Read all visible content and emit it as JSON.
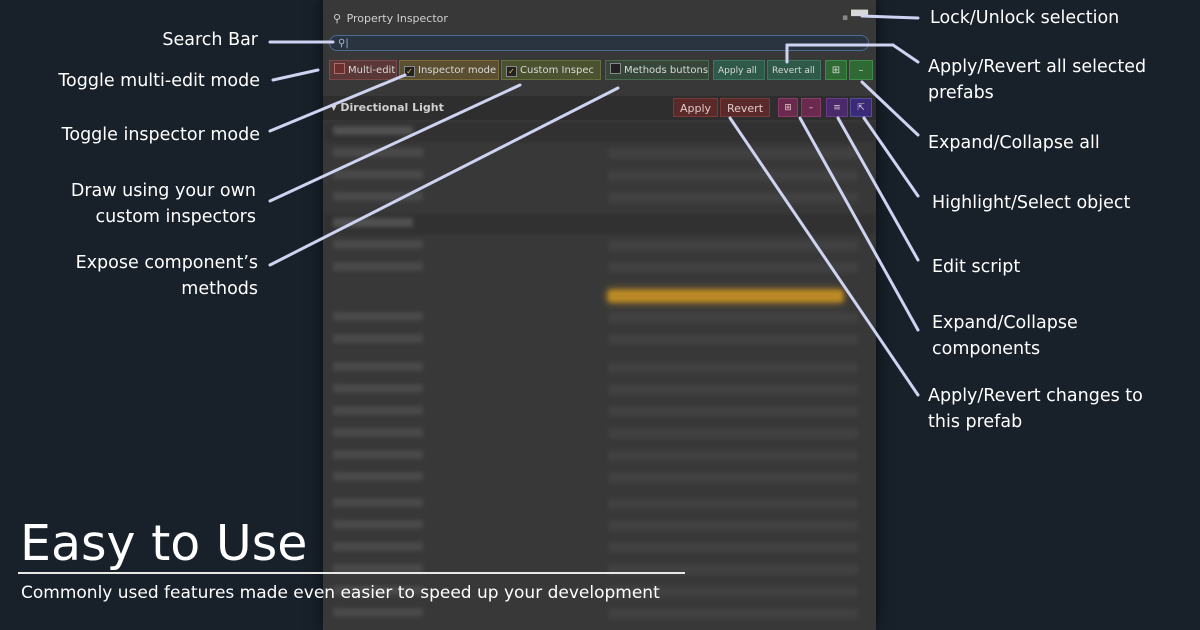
{
  "panel": {
    "title": "Property Inspector",
    "search_placeholder": "",
    "toolbar": {
      "multi_edit": "Multi-edit",
      "inspector_mode": "Inspector mode",
      "custom_inspectors": "Custom Inspec",
      "methods_buttons": "Methods buttons",
      "apply_all": "Apply all",
      "revert_all": "Revert all",
      "expand_all": "⊞",
      "collapse_all": "–"
    },
    "component": {
      "name": "Directional Light",
      "apply": "Apply",
      "revert": "Revert",
      "expand": "⊞",
      "collapse": "–",
      "edit": "≡",
      "select": "⇱"
    }
  },
  "annotations": {
    "search_bar": "Search Bar",
    "multi_edit": "Toggle multi-edit mode",
    "inspector_mode": "Toggle inspector mode",
    "custom_inspectors_1": "Draw using your own",
    "custom_inspectors_2": "custom inspectors",
    "methods_1": "Expose component’s",
    "methods_2": "methods",
    "lock": "Lock/Unlock selection",
    "apply_revert_all_1": "Apply/Revert all selected",
    "apply_revert_all_2": "prefabs",
    "expand_all": "Expand/Collapse all",
    "highlight": "Highlight/Select object",
    "edit_script": "Edit script",
    "expand_components_1": "Expand/Collapse",
    "expand_components_2": "components",
    "apply_revert_prefab_1": "Apply/Revert changes to",
    "apply_revert_prefab_2": "this prefab"
  },
  "hero": {
    "title": "Easy to Use",
    "subtitle": "Commonly used features made even easier to speed up your development"
  },
  "colors": {
    "background": "#18202a",
    "panel": "#383838",
    "leader_line": "#cfd3f2",
    "highlight_bar": "#e7a51d"
  }
}
